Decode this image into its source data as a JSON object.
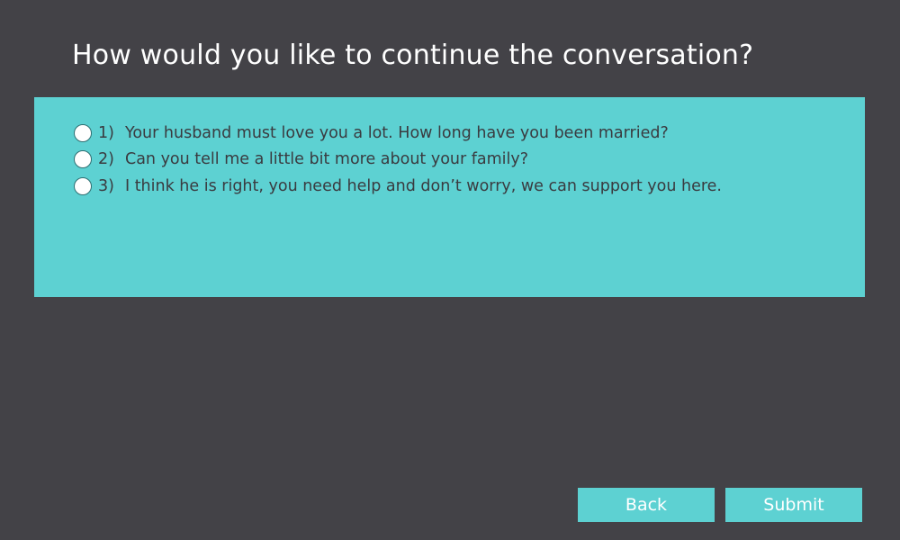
{
  "question": {
    "title": "How would you like to continue the conversation?"
  },
  "options": [
    {
      "number": "1)",
      "text": "Your husband must love you a lot. How long have you been married?"
    },
    {
      "number": "2)",
      "text": "Can you tell me a little bit more about your family?"
    },
    {
      "number": "3)",
      "text": "I think he is right, you need help and don’t worry, we can support you here."
    }
  ],
  "buttons": {
    "back_label": "Back",
    "submit_label": "Submit"
  },
  "colors": {
    "background": "#434247",
    "panel": "#5dd1d2",
    "text_dark": "#3a3b40",
    "text_light": "#ffffff"
  }
}
